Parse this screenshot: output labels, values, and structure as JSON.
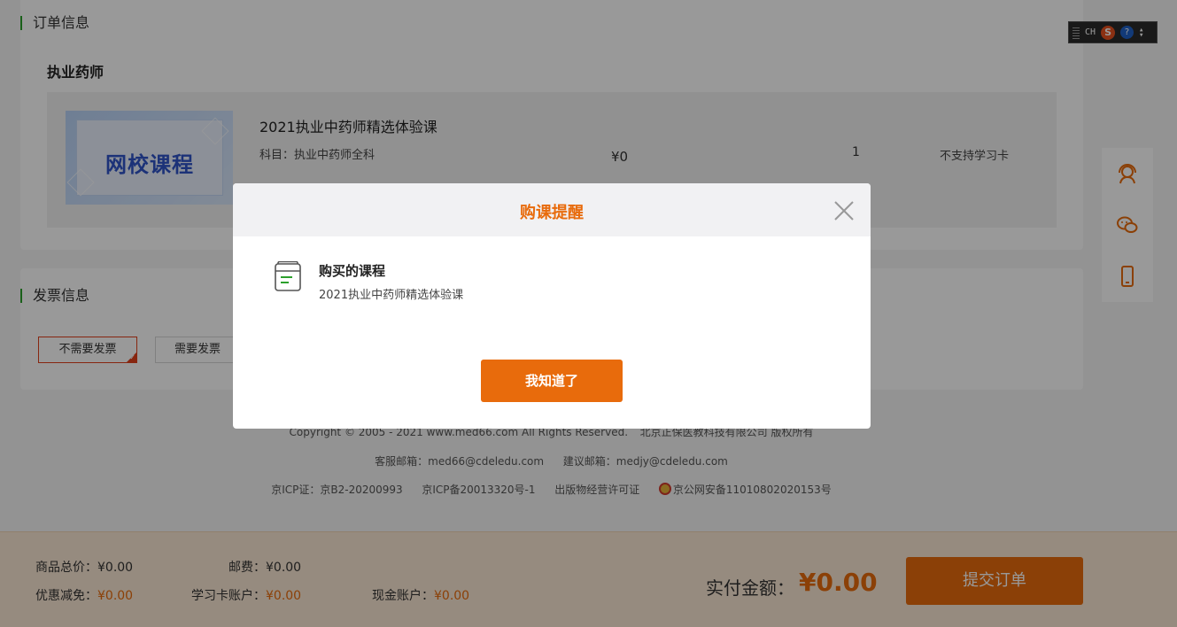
{
  "order": {
    "section_title": "订单信息",
    "category": "执业药师",
    "course": {
      "thumbnail_text": "网校课程",
      "name": "2021执业中药师精选体验课",
      "subject": "科目：执业中药师全科",
      "price": "¥0",
      "quantity": "1",
      "study_card": "不支持学习卡"
    }
  },
  "invoice": {
    "section_title": "发票信息",
    "options": [
      "不需要发票",
      "需要发票"
    ],
    "selected": "不需要发票"
  },
  "footer": {
    "copyright_text": "Copyright © 2005 - 2021 www.med66.com All Rights Reserved.",
    "company_text": "北京正保医教科技有限公司 版权所有",
    "service_email": "客服邮箱：med66@cdeledu.com",
    "suggest_email": "建议邮箱：medjy@cdeledu.com",
    "icp": "京ICP证：京B2-20200993",
    "icp_record": "京ICP备20013320号-1",
    "publication": "出版物经营许可证",
    "police_record": "京公网安备11010802020153号"
  },
  "side_tools": [
    {
      "name": "customer-service",
      "icon": "headset-icon"
    },
    {
      "name": "wechat",
      "icon": "wechat-icon"
    },
    {
      "name": "mobile",
      "icon": "mobile-icon"
    }
  ],
  "ime": {
    "lang": "CH"
  },
  "summary": {
    "goods_total_label": "商品总价：",
    "goods_total_value": "¥0.00",
    "shipping_label": "邮费：",
    "shipping_value": "¥0.00",
    "discount_label": "优惠减免：",
    "discount_value": "¥0.00",
    "card_label": "学习卡账户：",
    "card_value": "¥0.00",
    "cash_label": "现金账户：",
    "cash_value": "¥0.00",
    "pay_label": "实付金额：",
    "pay_value": "¥0.00",
    "submit_label": "提交订单"
  },
  "modal": {
    "title": "购课提醒",
    "label": "购买的课程",
    "course": "2021执业中药师精选体验课",
    "ok_label": "我知道了"
  },
  "colors": {
    "accent": "#e86b0c",
    "green_marker": "#2ca02c",
    "invoice_selected": "#e2401c",
    "overlay": "rgba(0,0,0,0.4)"
  }
}
